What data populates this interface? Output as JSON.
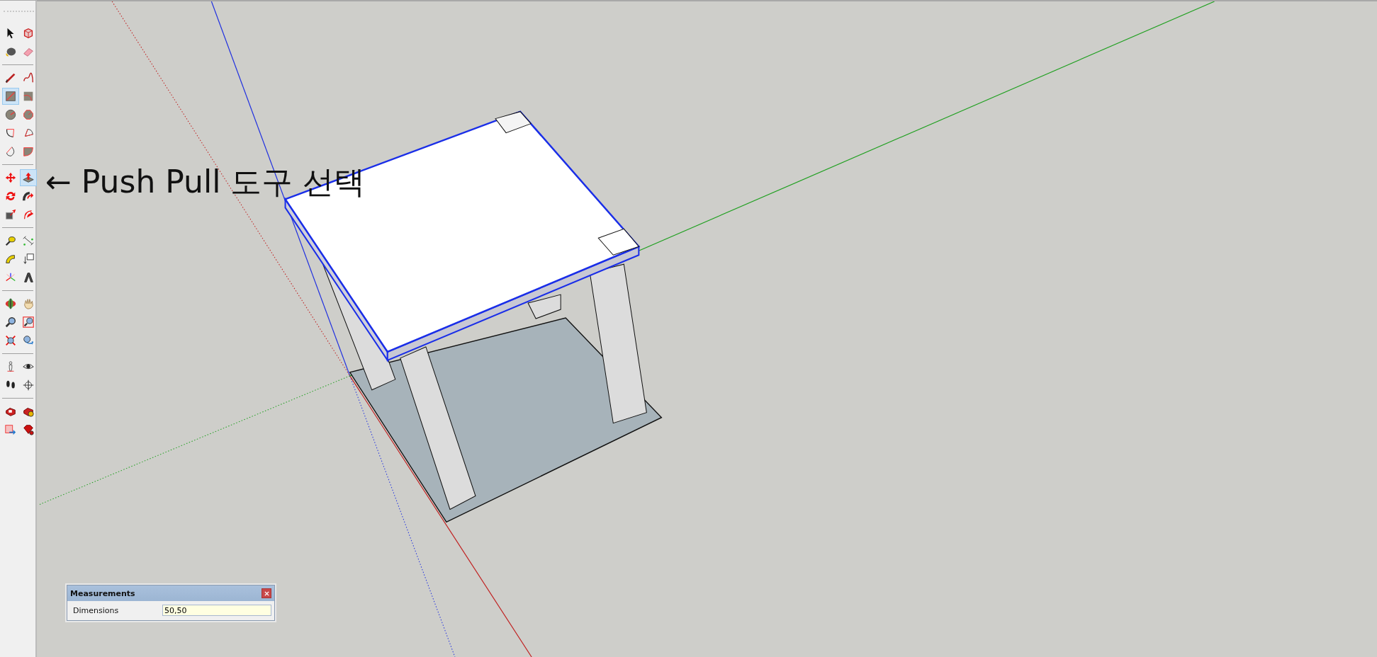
{
  "toolbar": {
    "groups": [
      [
        {
          "kind": "select",
          "selected": false
        },
        {
          "kind": "component",
          "selected": false
        },
        {
          "kind": "paint",
          "selected": false
        },
        {
          "kind": "eraser",
          "selected": false
        }
      ],
      [
        {
          "kind": "line",
          "selected": false
        },
        {
          "kind": "freehand",
          "selected": false
        },
        {
          "kind": "rectangle",
          "selected": true
        },
        {
          "kind": "rotated_rectangle",
          "selected": false
        },
        {
          "kind": "circle",
          "selected": false
        },
        {
          "kind": "polygon",
          "selected": false
        },
        {
          "kind": "arc",
          "selected": false
        },
        {
          "kind": "pie",
          "selected": false
        },
        {
          "kind": "arc3",
          "selected": false
        },
        {
          "kind": "pie2",
          "selected": false
        }
      ],
      [
        {
          "kind": "move",
          "selected": false
        },
        {
          "kind": "pushpull",
          "selected": true
        },
        {
          "kind": "rotate",
          "selected": false
        },
        {
          "kind": "followme",
          "selected": false
        },
        {
          "kind": "scale",
          "selected": false
        },
        {
          "kind": "offset",
          "selected": false
        }
      ],
      [
        {
          "kind": "tape",
          "selected": false
        },
        {
          "kind": "dimension",
          "selected": false
        },
        {
          "kind": "protractor",
          "selected": false
        },
        {
          "kind": "text",
          "selected": false
        },
        {
          "kind": "axes",
          "selected": false
        },
        {
          "kind": "text3d",
          "selected": false
        }
      ],
      [
        {
          "kind": "orbit",
          "selected": false
        },
        {
          "kind": "pan",
          "selected": false
        },
        {
          "kind": "zoom",
          "selected": false
        },
        {
          "kind": "zoom_window",
          "selected": false
        },
        {
          "kind": "zoom_extents",
          "selected": false
        },
        {
          "kind": "previous",
          "selected": false
        }
      ],
      [
        {
          "kind": "position_camera",
          "selected": false
        },
        {
          "kind": "look_around",
          "selected": false
        },
        {
          "kind": "walk",
          "selected": false
        },
        {
          "kind": "section",
          "selected": false
        }
      ],
      [
        {
          "kind": "warehouse",
          "selected": false
        },
        {
          "kind": "extension_warehouse",
          "selected": false
        },
        {
          "kind": "layout",
          "selected": false
        },
        {
          "kind": "extension_manager",
          "selected": false
        }
      ]
    ]
  },
  "annotation": {
    "text": "← Push Pull 도구 선택"
  },
  "measurements": {
    "title": "Measurements",
    "label": "Dimensions",
    "value": "50,50"
  }
}
